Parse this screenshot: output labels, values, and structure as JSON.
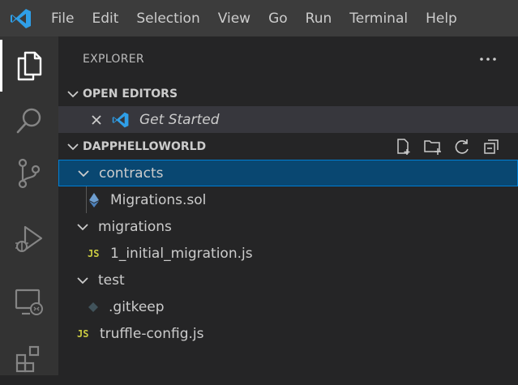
{
  "menu": [
    "File",
    "Edit",
    "Selection",
    "View",
    "Go",
    "Run",
    "Terminal",
    "Help"
  ],
  "sidebar": {
    "title": "EXPLORER",
    "open_editors": {
      "header": "OPEN EDITORS",
      "items": [
        {
          "label": "Get Started",
          "icon": "vscode-logo-icon"
        }
      ]
    },
    "workspace": {
      "header": "DAPPHELLOWORLD",
      "tree": [
        {
          "label": "contracts",
          "type": "folder",
          "expanded": true,
          "selected": true
        },
        {
          "label": "Migrations.sol",
          "type": "file",
          "icon": "ethereum-icon"
        },
        {
          "label": "migrations",
          "type": "folder",
          "expanded": true
        },
        {
          "label": "1_initial_migration.js",
          "type": "file",
          "icon": "js-icon",
          "badge": "JS"
        },
        {
          "label": "test",
          "type": "folder",
          "expanded": true
        },
        {
          "label": ".gitkeep",
          "type": "file",
          "icon": "git-icon"
        },
        {
          "label": "truffle-config.js",
          "type": "file",
          "icon": "js-icon",
          "badge": "JS"
        }
      ]
    }
  },
  "colors": {
    "titlebar": "#3c3c3c",
    "activitybar": "#333333",
    "sidebar": "#252526",
    "selection": "#094771",
    "focus_border": "#007fd4",
    "js_yellow": "#cbcb41",
    "vscode_blue": "#2f9fe8"
  }
}
